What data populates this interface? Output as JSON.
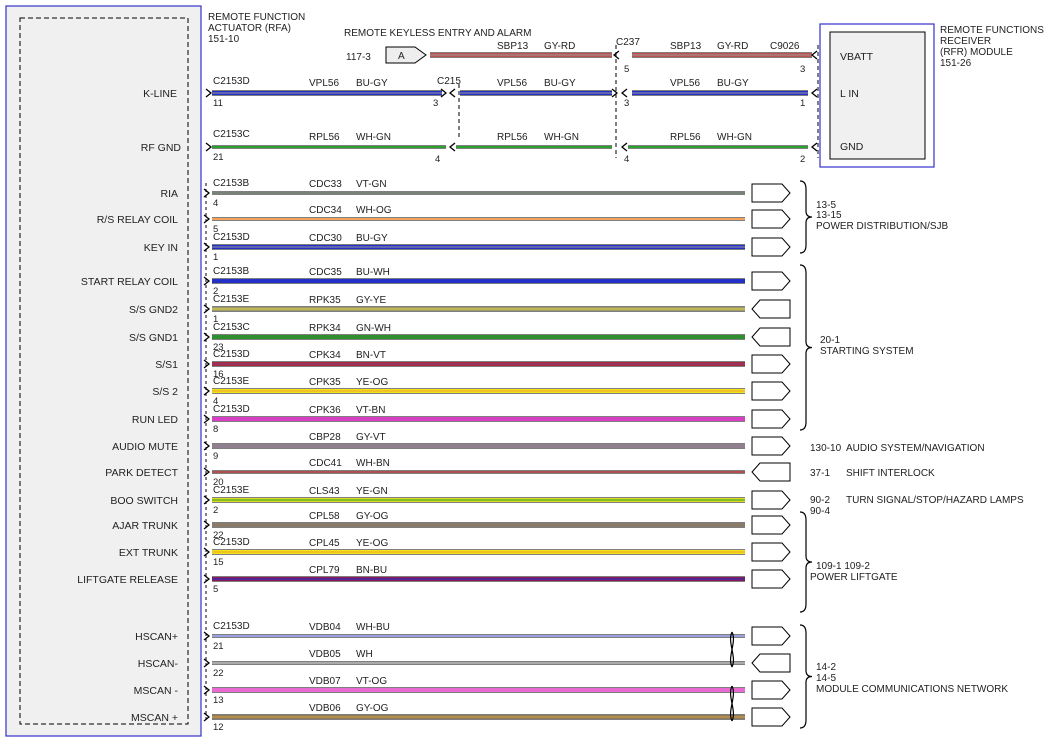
{
  "rfa": {
    "title": [
      "REMOTE FUNCTION",
      "ACTUATOR (RFA)",
      "151-10"
    ]
  },
  "rfr": {
    "title": [
      "REMOTE FUNCTIONS",
      "RECEIVER",
      "(RFR) MODULE",
      "151-26"
    ],
    "pins": [
      "VBATT",
      "L IN",
      "GND"
    ]
  },
  "keyless": {
    "title": "REMOTE KEYLESS ENTRY AND ALARM",
    "ref": "117-3",
    "conn_label": "A"
  },
  "top_wires": [
    {
      "name": "VBATT",
      "segments": [
        {
          "circuit": "SBP13",
          "color_code": "GY-RD",
          "color": "#c0504d",
          "stripe": "#999999"
        },
        {
          "circuit": "SBP13",
          "color_code": "GY-RD",
          "color": "#c0504d",
          "stripe": "#999999"
        }
      ],
      "connectors": [
        {
          "name": "C237",
          "pin": "5"
        },
        {
          "name": "C9026",
          "pin": "3"
        }
      ]
    },
    {
      "name": "K-LINE",
      "segments": [
        {
          "circuit": "VPL56",
          "color_code": "BU-GY",
          "color": "#2330c8",
          "stripe": "#999999"
        },
        {
          "circuit": "VPL56",
          "color_code": "BU-GY",
          "color": "#2330c8",
          "stripe": "#999999"
        },
        {
          "circuit": "VPL56",
          "color_code": "BU-GY",
          "color": "#2330c8",
          "stripe": "#999999"
        }
      ],
      "connectors": [
        {
          "name": "C2153D",
          "pin": "11"
        },
        {
          "name": "C215",
          "pin": "3"
        },
        {
          "name": "",
          "pin": "3"
        },
        {
          "name": "",
          "pin": "1"
        }
      ]
    },
    {
      "name": "RF GND",
      "segments": [
        {
          "circuit": "RPL56",
          "color_code": "WH-GN",
          "color": "#2ca02c",
          "stripe": ""
        },
        {
          "circuit": "RPL56",
          "color_code": "WH-GN",
          "color": "#2ca02c",
          "stripe": ""
        },
        {
          "circuit": "RPL56",
          "color_code": "WH-GN",
          "color": "#2ca02c",
          "stripe": ""
        }
      ],
      "connectors": [
        {
          "name": "C2153C",
          "pin": "21"
        },
        {
          "name": "",
          "pin": "4"
        },
        {
          "name": "",
          "pin": "4"
        },
        {
          "name": "",
          "pin": "2"
        }
      ]
    }
  ],
  "wires": [
    {
      "label": "RIA",
      "connector": "C2153B",
      "pin": "4",
      "circuit": "CDC33",
      "color_code": "VT-GN",
      "color": "#b36ab3",
      "stripe": "#3c9a3c",
      "thick": false
    },
    {
      "label": "R/S RELAY COIL",
      "connector": "",
      "pin": "5",
      "circuit": "CDC34",
      "color_code": "WH-OG",
      "color": "#f5a25a",
      "stripe": "",
      "thick": false
    },
    {
      "label": "KEY IN",
      "connector": "C2153D",
      "pin": "1",
      "circuit": "CDC30",
      "color_code": "BU-GY",
      "color": "#2330c8",
      "stripe": "#999999",
      "thick": true
    },
    {
      "label": "START RELAY COIL",
      "connector": "C2153B",
      "pin": "2",
      "circuit": "CDC35",
      "color_code": "BU-WH",
      "color": "#2330c8",
      "stripe": "",
      "thick": true
    },
    {
      "label": "S/S GND2",
      "connector": "C2153E",
      "pin": "1",
      "circuit": "RPK35",
      "color_code": "GY-YE",
      "color": "#9a9a6a",
      "stripe": "#e6d640",
      "thick": true
    },
    {
      "label": "S/S GND1",
      "connector": "C2153C",
      "pin": "23",
      "circuit": "RPK34",
      "color_code": "GN-WH",
      "color": "#2f8f2f",
      "stripe": "",
      "thick": true
    },
    {
      "label": "S/S1",
      "connector": "C2153D",
      "pin": "16",
      "circuit": "CPK34",
      "color_code": "BN-VT",
      "color": "#a52a3a",
      "stripe": "#8a3a8a",
      "thick": true
    },
    {
      "label": "S/S 2",
      "connector": "C2153E",
      "pin": "4",
      "circuit": "CPK35",
      "color_code": "YE-OG",
      "color": "#f2e416",
      "stripe": "#f0a030",
      "thick": true
    },
    {
      "label": "RUN LED",
      "connector": "C2153D",
      "pin": "8",
      "circuit": "CPK36",
      "color_code": "VT-BN",
      "color": "#d93fc4",
      "stripe": "",
      "thick": true
    },
    {
      "label": "AUDIO MUTE",
      "connector": "",
      "pin": "9",
      "circuit": "CBP28",
      "color_code": "GY-VT",
      "color": "#8f7f8f",
      "stripe": "",
      "thick": true
    },
    {
      "label": "PARK DETECT",
      "connector": "",
      "pin": "20",
      "circuit": "CDC41",
      "color_code": "WH-BN",
      "color": "#b05050",
      "stripe": "",
      "thick": false
    },
    {
      "label": "BOO SWITCH",
      "connector": "C2153E",
      "pin": "2",
      "circuit": "CLS43",
      "color_code": "YE-GN",
      "color": "#dcdc20",
      "stripe": "#2ca02c",
      "thick": true
    },
    {
      "label": "AJAR TRUNK",
      "connector": "",
      "pin": "22",
      "circuit": "CPL58",
      "color_code": "GY-OG",
      "color": "#8a7a6a",
      "stripe": "",
      "thick": true
    },
    {
      "label": "EXT TRUNK",
      "connector": "C2153D",
      "pin": "15",
      "circuit": "CPL45",
      "color_code": "YE-OG",
      "color": "#f2e416",
      "stripe": "#f0a030",
      "thick": true
    },
    {
      "label": "LIFTGATE RELEASE",
      "connector": "",
      "pin": "5",
      "circuit": "CPL79",
      "color_code": "BN-BU",
      "color": "#8a1a5a",
      "stripe": "#2330c8",
      "thick": true
    },
    {
      "label": "HSCAN+",
      "connector": "C2153D",
      "pin": "21",
      "circuit": "VDB04",
      "color_code": "WH-BU",
      "color": "#9aa0e0",
      "stripe": "",
      "thick": false
    },
    {
      "label": "HSCAN-",
      "connector": "",
      "pin": "22",
      "circuit": "VDB05",
      "color_code": "WH",
      "color": "#aaaaaa",
      "stripe": "",
      "thick": false
    },
    {
      "label": "MSCAN -",
      "connector": "",
      "pin": "13",
      "circuit": "VDB07",
      "color_code": "VT-OG",
      "color": "#e86ad2",
      "stripe": "",
      "thick": true
    },
    {
      "label": "MSCAN +",
      "connector": "",
      "pin": "12",
      "circuit": "VDB06",
      "color_code": "GY-OG",
      "color": "#8a7a5a",
      "stripe": "#e0a040",
      "thick": true
    }
  ],
  "groups": [
    {
      "refs": [
        "13-5",
        "13-15"
      ],
      "title": "POWER DISTRIBUTION/SJB"
    },
    {
      "refs": [
        "20-1"
      ],
      "title": "STARTING SYSTEM"
    },
    {
      "refs": [
        "130-10"
      ],
      "title": "AUDIO SYSTEM/NAVIGATION"
    },
    {
      "refs": [
        "37-1"
      ],
      "title": "SHIFT INTERLOCK"
    },
    {
      "refs": [
        "90-2",
        "90-4"
      ],
      "title": "TURN SIGNAL/STOP/HAZARD LAMPS"
    },
    {
      "refs": [
        "109-1   109-2"
      ],
      "title": "POWER LIFTGATE"
    },
    {
      "refs": [
        "14-2",
        "14-5"
      ],
      "title": "MODULE COMMUNICATIONS NETWORK"
    }
  ],
  "palette": {
    "module_border": "#3333cc",
    "module_fill": "#f0f0f0",
    "line": "#000000"
  }
}
